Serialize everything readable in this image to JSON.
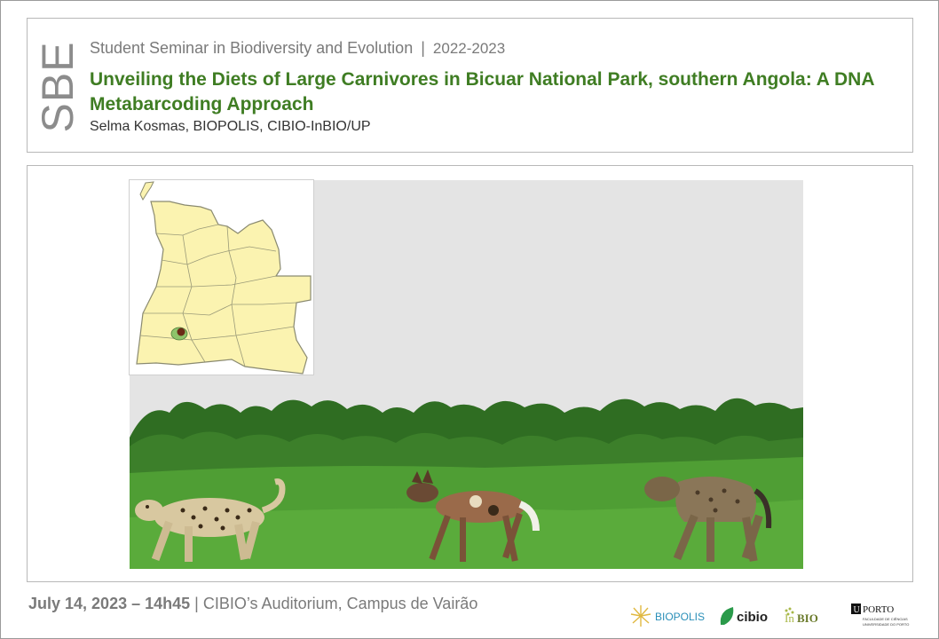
{
  "logo": {
    "text": "SBE"
  },
  "header": {
    "seminar": "Student Seminar in Biodiversity and Evolution",
    "separator": "|",
    "year": "2022-2023",
    "title": "Unveiling the Diets of Large Carnivores in Bicuar National Park, southern Angola: A DNA Metabarcoding Approach",
    "speaker": "Selma Kosmas, BIOPOLIS, CIBIO-InBIO/UP"
  },
  "footer": {
    "date": "July 14, 2023 – 14h45",
    "separator": "|",
    "location": "CIBIO’s Auditorium,  Campus de Vairão"
  },
  "partner_logos": {
    "biopolis": "BIOPOLIS",
    "cibio": "cibio",
    "inbio_prefix": "In",
    "inbio_suffix": "BIO",
    "uporto_u": "U",
    "uporto_name": "PORTO",
    "uporto_faculty": "FACULDADE DE CIÊNCIAS",
    "uporto_university": "UNIVERSIDADE DO PORTO"
  },
  "colors": {
    "title_green": "#3f7d23",
    "gray_text": "#7a7a7a",
    "map_fill": "#fbf3b0",
    "park_green": "#8ec46a",
    "park_brown": "#6b2b16",
    "sky": "#e4e4e4",
    "grass": "#4f9e34",
    "trees": "#2f6d22"
  },
  "icons": {
    "biopolis": "sunburst-icon",
    "cibio": "leaf-icon",
    "inbio": "dotted-leaf-icon",
    "uporto": "university-seal-icon"
  }
}
